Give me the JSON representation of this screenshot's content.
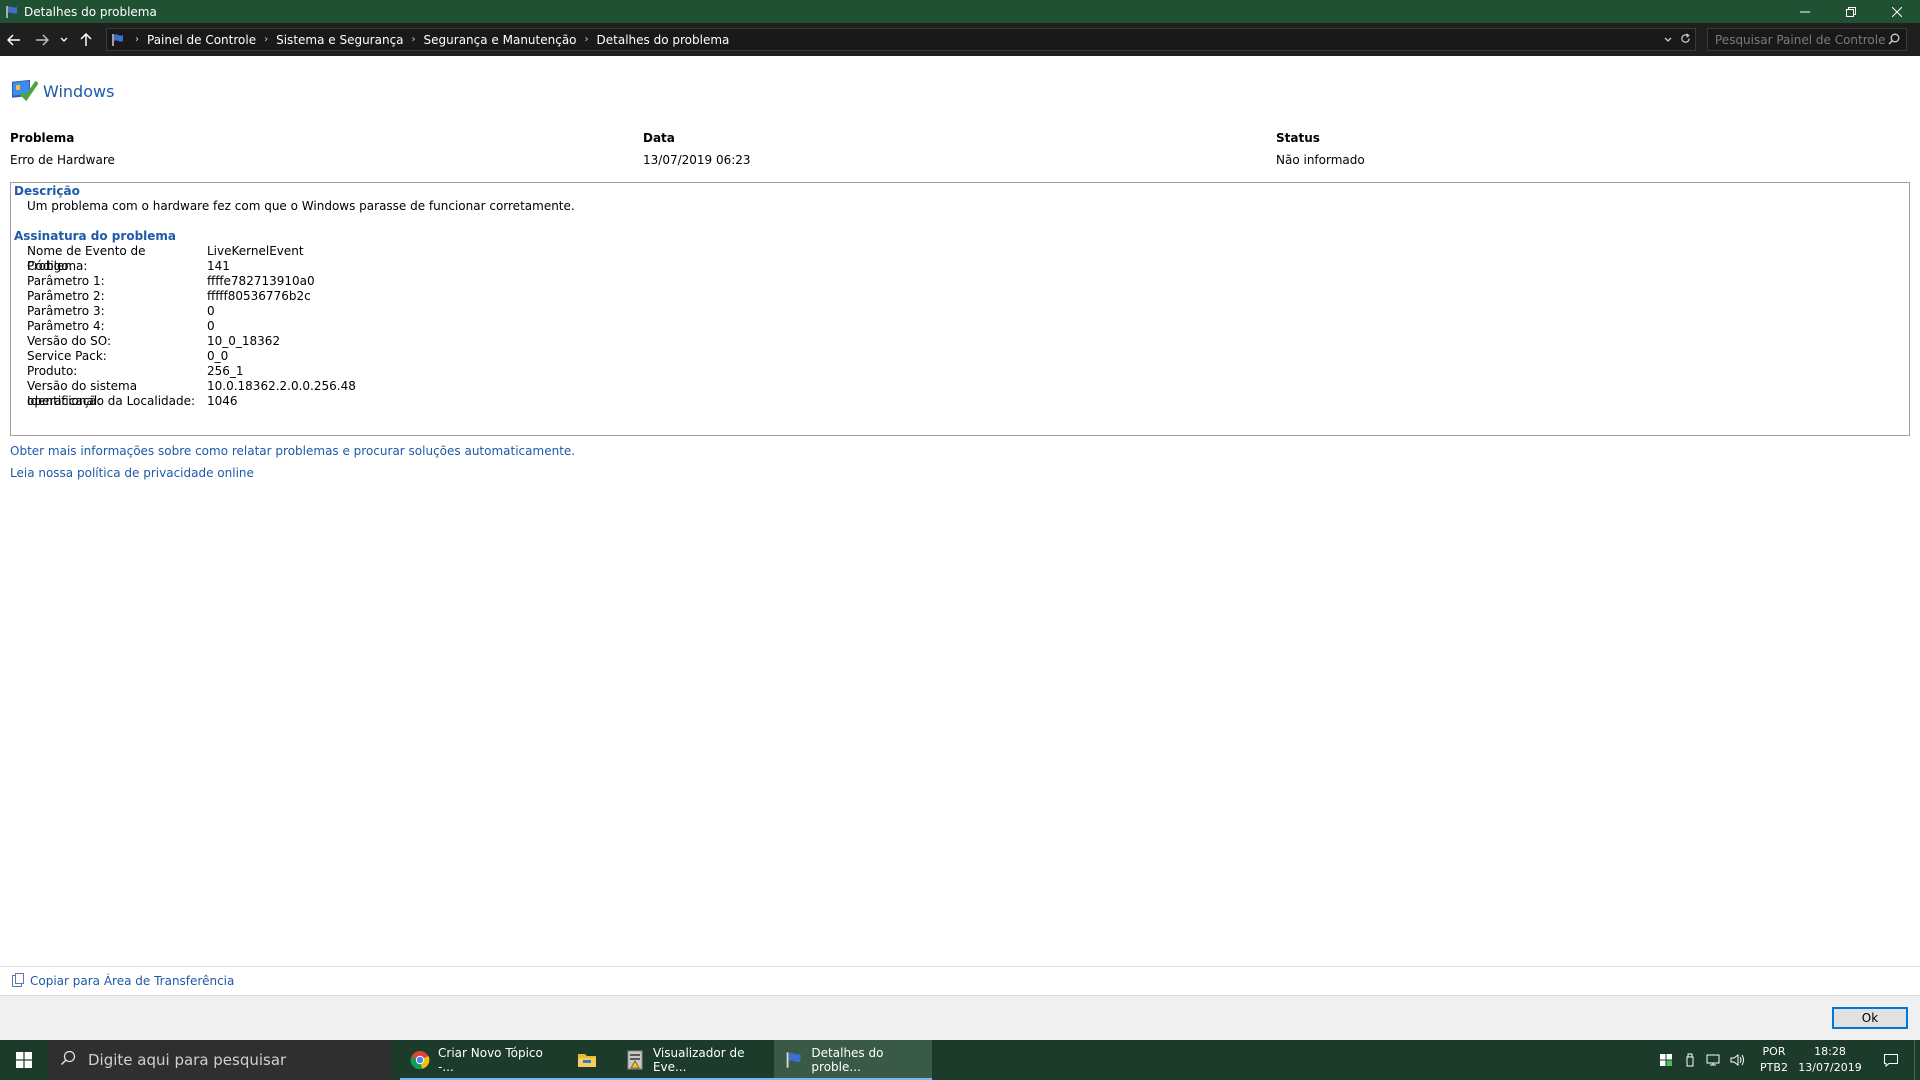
{
  "window": {
    "title": "Detalhes do problema"
  },
  "address": {
    "breadcrumbs": [
      "Painel de Controle",
      "Sistema e Segurança",
      "Segurança e Manutenção",
      "Detalhes do problema"
    ],
    "search_placeholder": "Pesquisar Painel de Controle"
  },
  "brand": {
    "name": "Windows"
  },
  "summary": {
    "headers": {
      "problem": "Problema",
      "date": "Data",
      "status": "Status"
    },
    "values": {
      "problem": "Erro de Hardware",
      "date": "13/07/2019 06:23",
      "status": "Não informado"
    }
  },
  "description": {
    "title": "Descrição",
    "text": "Um problema com o hardware fez com que o Windows parasse de funcionar corretamente."
  },
  "signature": {
    "title": "Assinatura do problema",
    "rows": [
      {
        "key": "Nome de Evento de Problema:",
        "value": "LiveKernelEvent"
      },
      {
        "key": "Código:",
        "value": "141"
      },
      {
        "key": "Parâmetro 1:",
        "value": "ffffe782713910a0"
      },
      {
        "key": "Parâmetro 2:",
        "value": "fffff80536776b2c"
      },
      {
        "key": "Parâmetro 3:",
        "value": "0"
      },
      {
        "key": "Parâmetro 4:",
        "value": "0"
      },
      {
        "key": "Versão do SO:",
        "value": "10_0_18362"
      },
      {
        "key": "Service Pack:",
        "value": "0_0"
      },
      {
        "key": "Produto:",
        "value": "256_1"
      },
      {
        "key": "Versão do sistema operacional:",
        "value": "10.0.18362.2.0.0.256.48"
      },
      {
        "key": "Identificação da Localidade:",
        "value": "1046"
      }
    ]
  },
  "links": {
    "more_info": "Obter mais informações sobre como relatar problemas e procurar soluções automaticamente.",
    "privacy": "Leia nossa política de privacidade online"
  },
  "bottom": {
    "copy_label": "Copiar para Área de Transferência",
    "ok_label": "Ok"
  },
  "taskbar": {
    "search_placeholder": "Digite aqui para pesquisar",
    "apps": [
      {
        "label": "Criar Novo Tópico -...",
        "icon": "chrome-icon"
      },
      {
        "label": "",
        "icon": "file-explorer-icon"
      },
      {
        "label": "Visualizador de Eve...",
        "icon": "event-viewer-icon"
      },
      {
        "label": "Detalhes do proble...",
        "icon": "flag-icon"
      }
    ],
    "lang_line1": "POR",
    "lang_line2": "PTB2",
    "time": "18:28",
    "date": "13/07/2019"
  }
}
